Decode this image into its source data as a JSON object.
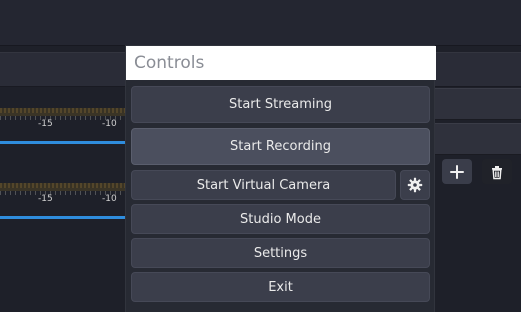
{
  "panel": {
    "title": "Controls"
  },
  "controls": {
    "start_streaming": "Start Streaming",
    "start_recording": "Start Recording",
    "start_virtual_camera": "Start Virtual Camera",
    "studio_mode": "Studio Mode",
    "settings": "Settings",
    "exit": "Exit"
  },
  "audio_meters": [
    {
      "tick_labels": [
        "-15",
        "-10"
      ]
    },
    {
      "tick_labels": [
        "-15",
        "-10"
      ]
    }
  ],
  "icons": {
    "gear": "gear-icon",
    "add": "plus-icon",
    "delete": "trash-icon"
  },
  "colors": {
    "accent_blue": "#2f8ddd",
    "panel_bg": "#272a33",
    "button_bg": "#3b3e4b"
  }
}
